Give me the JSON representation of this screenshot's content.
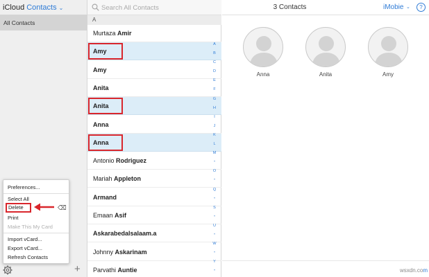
{
  "header": {
    "brand": "iCloud",
    "app": "Contacts",
    "count": "3 Contacts",
    "user": "iMobie",
    "help": "?"
  },
  "sidebar": {
    "groups": [
      {
        "label": "All Contacts"
      }
    ]
  },
  "settings_menu": {
    "items": [
      {
        "label": "Preferences...",
        "enabled": true
      },
      {
        "label": "Select All",
        "enabled": true
      },
      {
        "label": "Delete",
        "enabled": true,
        "highlighted": true
      },
      {
        "label": "Print",
        "enabled": true
      },
      {
        "label": "Make This My Card",
        "enabled": false
      },
      {
        "label": "Import vCard...",
        "enabled": true
      },
      {
        "label": "Export vCard...",
        "enabled": true
      },
      {
        "label": "Refresh Contacts",
        "enabled": true
      }
    ]
  },
  "search": {
    "placeholder": "Search All Contacts"
  },
  "list": {
    "section": "A",
    "contacts": [
      {
        "first": "Murtaza",
        "last": "Amir",
        "selected": false,
        "highlighted": false
      },
      {
        "first": "",
        "last": "Amy",
        "selected": true,
        "highlighted": true
      },
      {
        "first": "",
        "last": "Amy",
        "selected": false,
        "highlighted": false
      },
      {
        "first": "",
        "last": "Anita",
        "selected": false,
        "highlighted": false
      },
      {
        "first": "",
        "last": "Anita",
        "selected": true,
        "highlighted": true
      },
      {
        "first": "",
        "last": "Anna",
        "selected": false,
        "highlighted": false
      },
      {
        "first": "",
        "last": "Anna",
        "selected": true,
        "highlighted": true
      },
      {
        "first": "Antonio",
        "last": "Rodriguez",
        "selected": false,
        "highlighted": false
      },
      {
        "first": "Mariah",
        "last": "Appleton",
        "selected": false,
        "highlighted": false
      },
      {
        "first": "",
        "last": "Armand",
        "selected": false,
        "highlighted": false
      },
      {
        "first": "Emaan",
        "last": "Asif",
        "selected": false,
        "highlighted": false
      },
      {
        "first": "",
        "last": "Askarabedalsalaam.a",
        "selected": false,
        "highlighted": false
      },
      {
        "first": "Johnny",
        "last": "Askarinam",
        "selected": false,
        "highlighted": false
      },
      {
        "first": "Parvathi",
        "last": "Auntie",
        "selected": false,
        "highlighted": false
      }
    ],
    "index": [
      "A",
      "B",
      "C",
      "D",
      "E",
      "F",
      "G",
      "H",
      "I",
      "J",
      "K",
      "L",
      "M",
      "•",
      "O",
      "•",
      "Q",
      "•",
      "S",
      "•",
      "U",
      "•",
      "W",
      "•",
      "Y",
      "•"
    ]
  },
  "detail": {
    "cards": [
      {
        "name": "Anna"
      },
      {
        "name": "Anita"
      },
      {
        "name": "Amy"
      }
    ]
  },
  "watermark": {
    "text": "wsxdn.co",
    "tail": "m"
  },
  "colors": {
    "accent": "#2e7bd6",
    "selection": "#dcedf8",
    "callout": "#d9262c"
  }
}
